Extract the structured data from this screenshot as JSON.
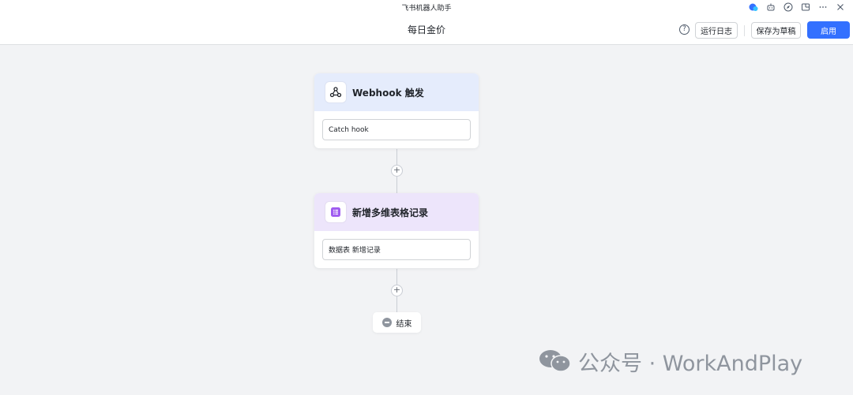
{
  "window": {
    "title": "飞书机器人助手",
    "icons": [
      "assistant-icon",
      "robot-icon",
      "compass-icon",
      "external-window-icon",
      "more-icon",
      "close-icon"
    ]
  },
  "header": {
    "page_title": "每日金价",
    "help_icon": "question-circle-icon",
    "log_label": "运行日志",
    "draft_label": "保存为草稿",
    "enable_label": "启用"
  },
  "colors": {
    "accent": "#3370ff",
    "trigger_header": "#e5ecfc",
    "action_header": "#ede5fb",
    "canvas": "#f2f3f5"
  },
  "flow": {
    "trigger": {
      "title": "Webhook 触发",
      "icon": "webhook-icon",
      "field": "Catch hook"
    },
    "action": {
      "title": "新增多维表格记录",
      "icon": "table-icon",
      "field": "数据表 新增记录"
    },
    "add_icon": "+",
    "end_label": "结束"
  },
  "watermark": {
    "text": "公众号 · WorkAndPlay"
  }
}
